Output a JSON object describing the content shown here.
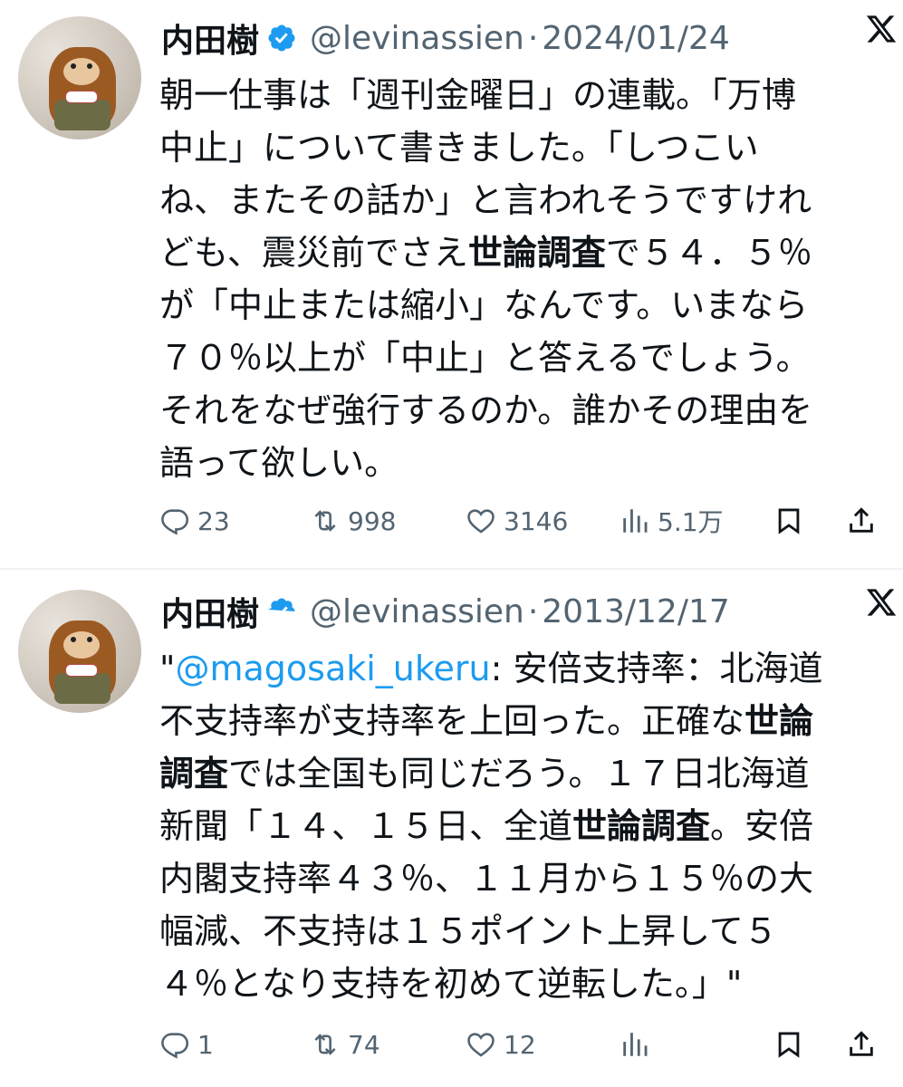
{
  "tweets": [
    {
      "author_name": "内田樹",
      "handle": "@levinassien",
      "separator": "·",
      "date": "2024/01/24",
      "lines": [
        [
          {
            "t": "朝一仕事は「週刊金曜日」の連載。「万博"
          }
        ],
        [
          {
            "t": "中止」について書きました。「しつこい"
          }
        ],
        [
          {
            "t": "ね、またその話か」と言われそうですけれ"
          }
        ],
        [
          {
            "t": "ども、震災前でさえ"
          },
          {
            "t": "世論調査",
            "bold": true
          },
          {
            "t": "で５４．５％"
          }
        ],
        [
          {
            "t": "が「中止または縮小」なんです。いまなら"
          }
        ],
        [
          {
            "t": "７０％以上が「中止」と答えるでしょう。"
          }
        ],
        [
          {
            "t": "それをなぜ強行するのか。誰かその理由を"
          }
        ],
        [
          {
            "t": "語って欲しい。"
          }
        ]
      ],
      "replies": "23",
      "retweets": "998",
      "likes": "3146",
      "views": "5.1万"
    },
    {
      "author_name": "内田樹",
      "handle": "@levinassien",
      "separator": "·",
      "date": "2013/12/17",
      "lines": [
        [
          {
            "t": "\""
          },
          {
            "t": "@magosaki_ukeru",
            "link": true
          },
          {
            "t": ": 安倍支持率：北海道"
          }
        ],
        [
          {
            "t": "不支持率が支持率を上回った。正確な"
          },
          {
            "t": "世論",
            "bold": true
          }
        ],
        [
          {
            "t": "調査",
            "bold": true
          },
          {
            "t": "では全国も同じだろう。１７日北海道"
          }
        ],
        [
          {
            "t": "新聞「１４、１５日、全道"
          },
          {
            "t": "世論調査",
            "bold": true
          },
          {
            "t": "。安倍"
          }
        ],
        [
          {
            "t": "内閣支持率４３％、１１月から１５％の大"
          }
        ],
        [
          {
            "t": "幅減、不支持は１５ポイント上昇して５"
          }
        ],
        [
          {
            "t": "４％となり支持を初めて逆転した。」\""
          }
        ]
      ],
      "replies": "1",
      "retweets": "74",
      "likes": "12",
      "views": ""
    }
  ],
  "colors": {
    "text": "#0f1419",
    "secondary": "#536471",
    "link": "#1d9bf0",
    "verified": "#1d9bf0",
    "separator": "#eff3f4"
  },
  "icons": {
    "verified": "verified-badge-icon",
    "x": "x-logo-icon",
    "reply": "reply-icon",
    "retweet": "retweet-icon",
    "like": "heart-icon",
    "views": "views-icon",
    "bookmark": "bookmark-icon",
    "share": "share-icon"
  }
}
